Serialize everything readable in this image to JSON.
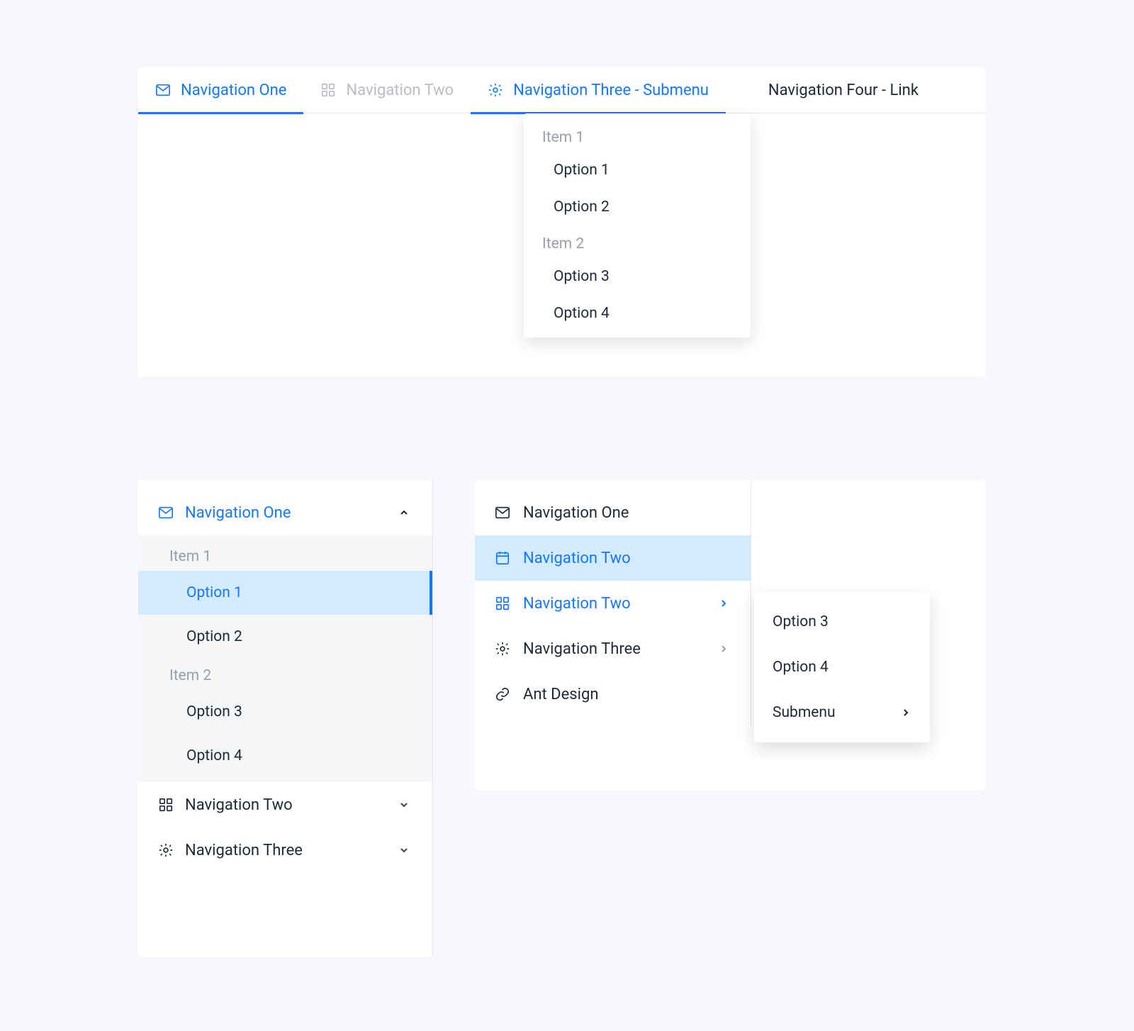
{
  "colors": {
    "primary": "#1677ff"
  },
  "horizontal_menu": {
    "items": [
      {
        "label": "Navigation One",
        "icon": "mail-icon",
        "state": "active"
      },
      {
        "label": "Navigation Two",
        "icon": "appstore-icon",
        "state": "disabled"
      },
      {
        "label": "Navigation Three - Submenu",
        "icon": "setting-icon",
        "state": "submenu-open"
      },
      {
        "label": "Navigation Four - Link",
        "icon": null,
        "state": "normal"
      }
    ],
    "dropdown": {
      "groups": [
        {
          "title": "Item 1",
          "options": [
            "Option 1",
            "Option 2"
          ]
        },
        {
          "title": "Item 2",
          "options": [
            "Option 3",
            "Option 4"
          ]
        }
      ]
    }
  },
  "inline_menu": {
    "items": [
      {
        "label": "Navigation One",
        "icon": "mail-icon",
        "open": true,
        "groups": [
          {
            "title": "Item 1",
            "options": [
              {
                "label": "Option 1",
                "selected": true
              },
              {
                "label": "Option 2",
                "selected": false
              }
            ]
          },
          {
            "title": "Item 2",
            "options": [
              {
                "label": "Option 3",
                "selected": false
              },
              {
                "label": "Option 4",
                "selected": false
              }
            ]
          }
        ]
      },
      {
        "label": "Navigation Two",
        "icon": "appstore-icon",
        "open": false
      },
      {
        "label": "Navigation Three",
        "icon": "setting-icon",
        "open": false
      }
    ]
  },
  "vertical_menu": {
    "items": [
      {
        "label": "Navigation One",
        "icon": "mail-icon",
        "state": "normal"
      },
      {
        "label": "Navigation Two",
        "icon": "calendar-icon",
        "state": "selected"
      },
      {
        "label": "Navigation Two",
        "icon": "appstore-icon",
        "state": "active-submenu",
        "has_submenu": true
      },
      {
        "label": "Navigation Three",
        "icon": "setting-icon",
        "state": "normal",
        "has_submenu": true
      },
      {
        "label": "Ant Design",
        "icon": "link-icon",
        "state": "normal"
      }
    ],
    "popout": {
      "items": [
        {
          "label": "Option 3"
        },
        {
          "label": "Option 4"
        },
        {
          "label": "Submenu",
          "has_submenu": true
        }
      ]
    }
  }
}
